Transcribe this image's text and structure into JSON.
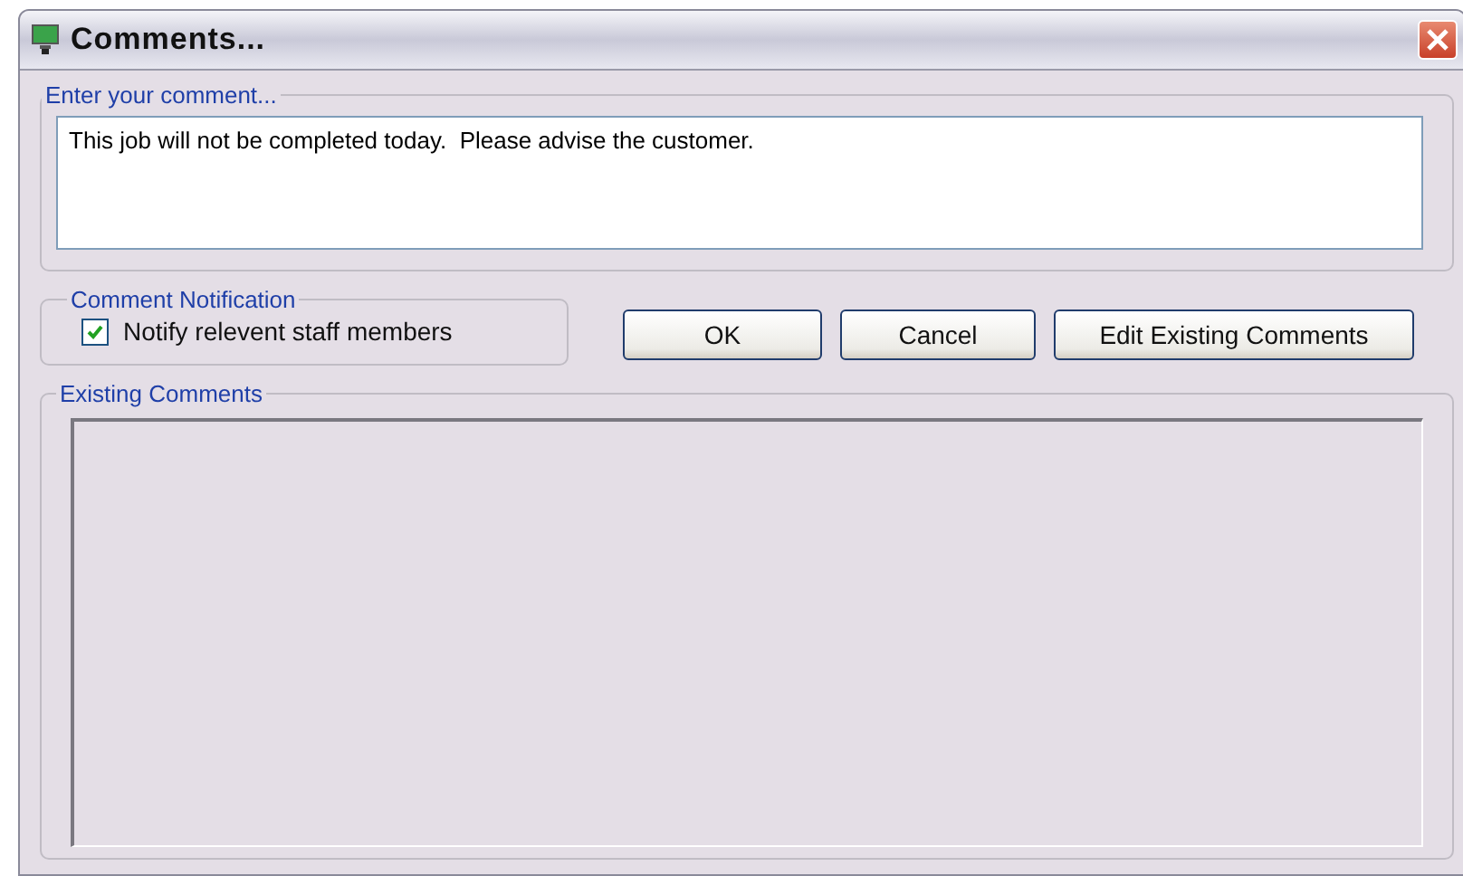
{
  "window": {
    "title": "Comments..."
  },
  "comment_group": {
    "legend": "Enter your comment...",
    "value": "This job will not be completed today.  Please advise the customer."
  },
  "notification_group": {
    "legend": "Comment Notification",
    "checkbox": {
      "label": "Notify relevent staff members",
      "checked": true
    }
  },
  "buttons": [
    "OK",
    "Cancel",
    "Edit Existing Comments"
  ],
  "existing_group": {
    "legend": "Existing Comments"
  }
}
